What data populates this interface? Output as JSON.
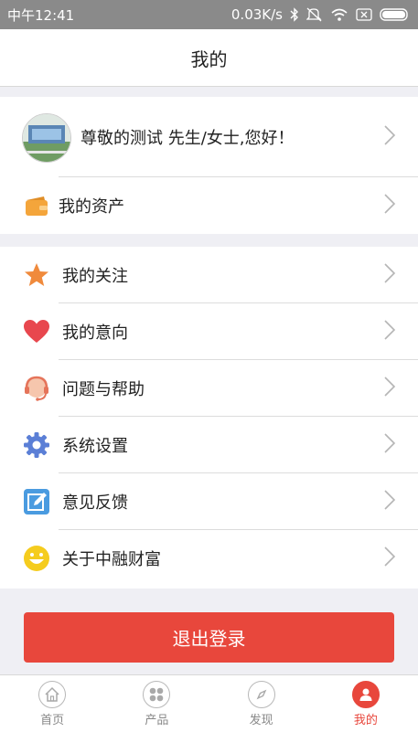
{
  "status": {
    "time": "中午12:41",
    "speed": "0.03K/s"
  },
  "header": {
    "title": "我的"
  },
  "profile": {
    "greeting": "尊敬的测试 先生/女士,您好！"
  },
  "assets": {
    "label": "我的资产"
  },
  "menu": [
    {
      "label": "我的关注",
      "icon": "star-icon"
    },
    {
      "label": "我的意向",
      "icon": "heart-icon"
    },
    {
      "label": "问题与帮助",
      "icon": "headset-icon"
    },
    {
      "label": "系统设置",
      "icon": "gear-icon"
    },
    {
      "label": "意见反馈",
      "icon": "edit-icon"
    },
    {
      "label": "关于中融财富",
      "icon": "smile-icon"
    }
  ],
  "logout": {
    "label": "退出登录"
  },
  "tabs": [
    {
      "label": "首页",
      "icon": "home-icon"
    },
    {
      "label": "产品",
      "icon": "products-icon"
    },
    {
      "label": "发现",
      "icon": "compass-icon"
    },
    {
      "label": "我的",
      "icon": "user-icon"
    }
  ],
  "colors": {
    "accent": "#e8473c",
    "wallet": "#f4a53b",
    "star": "#f08a3c",
    "heart": "#e8474e",
    "gear": "#5b7fd6",
    "edit": "#4a9be0",
    "smile": "#f5cc1e"
  }
}
